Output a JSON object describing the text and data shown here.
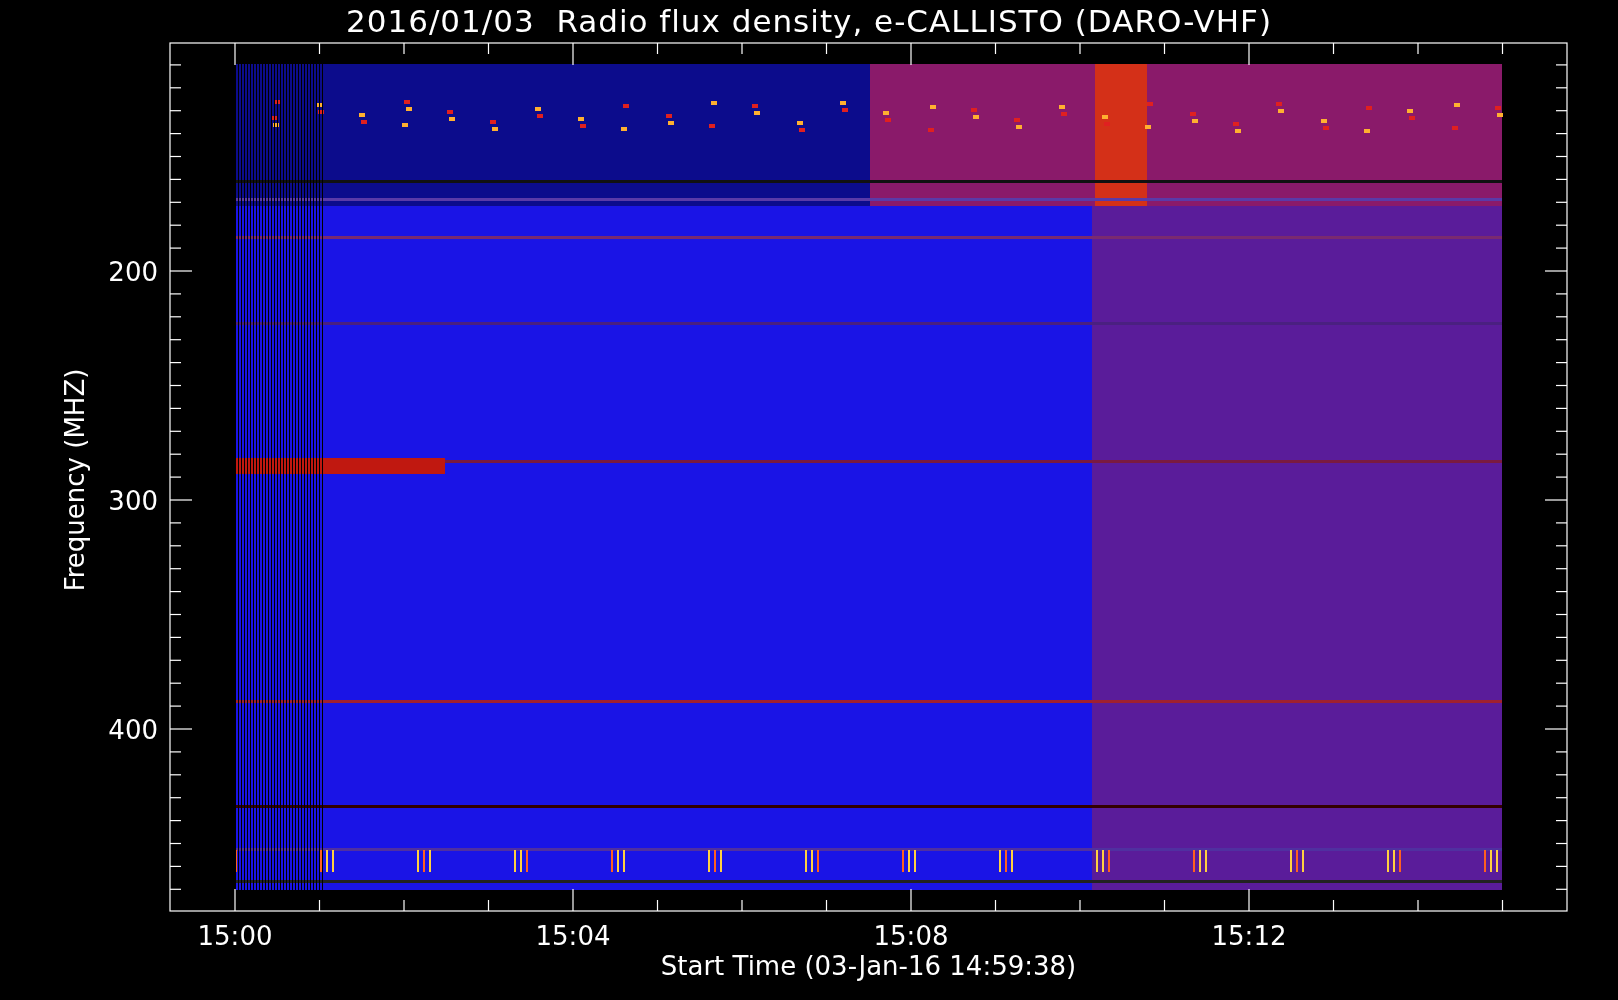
{
  "title": "2016/01/03  Radio flux density, e-CALLISTO (DARO-VHF)",
  "y_axis": {
    "label": "Frequency (MHZ)",
    "ticks": [
      "200",
      "300",
      "400"
    ]
  },
  "x_axis": {
    "label": "Start Time (03-Jan-16 14:59:38)",
    "ticks": [
      "15:00",
      "15:04",
      "15:08",
      "15:12"
    ]
  }
}
